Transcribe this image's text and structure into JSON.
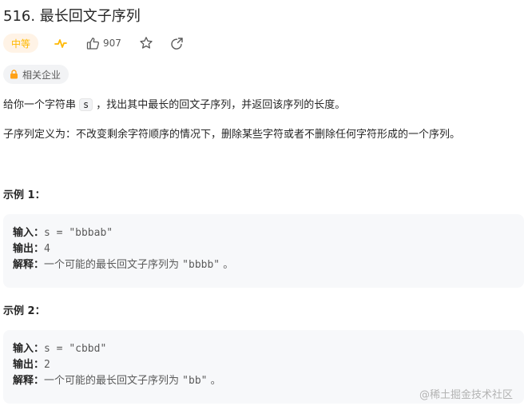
{
  "problem": {
    "title": "516. 最长回文子序列",
    "difficulty": "中等",
    "likes": "907",
    "company_tag": "相关企业"
  },
  "description": {
    "line1_before": "给你一个字符串",
    "line1_code": "s",
    "line1_after": "，找出其中最长的回文子序列，并返回该序列的长度。",
    "line2": "子序列定义为：不改变剩余字符顺序的情况下，删除某些字符或者不删除任何字符形成的一个序列。"
  },
  "examples": [
    {
      "title": "示例 1：",
      "input_label": "输入：",
      "input_value": "s = \"bbbab\"",
      "output_label": "输出：",
      "output_value": "4",
      "explain_label": "解释：",
      "explain_text": "一个可能的最长回文子序列为",
      "explain_code": "\"bbbb\"",
      "explain_end": "。"
    },
    {
      "title": "示例 2：",
      "input_label": "输入：",
      "input_value": "s = \"cbbd\"",
      "output_label": "输出：",
      "output_value": "2",
      "explain_label": "解释：",
      "explain_text": "一个可能的最长回文子序列为",
      "explain_code": "\"bb\"",
      "explain_end": "。"
    }
  ],
  "watermark": "@稀土掘金技术社区",
  "icons": {
    "activity": "activity-icon",
    "like": "thumbs-up-icon",
    "favorite": "star-icon",
    "share": "share-icon",
    "lock": "lock-icon"
  },
  "colors": {
    "difficulty_text": "#ffb800",
    "difficulty_bg": "#fff3e6",
    "lock_icon": "#ffa116"
  }
}
